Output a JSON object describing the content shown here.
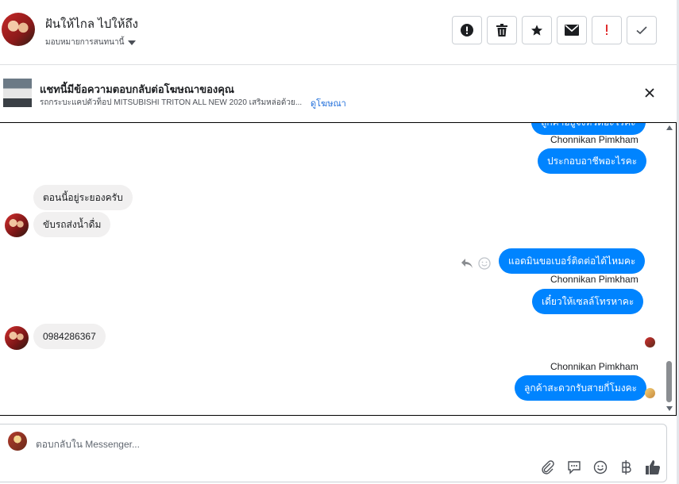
{
  "header": {
    "title": "ฝันให้ไกล ไปให้ถึง",
    "assign_label": "มอบหมายการสนทนานี้",
    "actions": [
      "exclamation-icon",
      "trash-icon",
      "star-icon",
      "envelope-icon",
      "flag-icon",
      "check-icon"
    ]
  },
  "ad_banner": {
    "title": "แชทนี้มีข้อความตอบกลับต่อโฆษณาของคุณ",
    "subtitle": "รถกระบะแคปตัวท็อป MITSUBISHI TRITON ALL NEW 2020 เสริมหล่อด้วย...",
    "link": "ดูโฆษณา"
  },
  "messages": {
    "m1_cut": "ลูกค้าอยู่จังหวัดอะไรคะ",
    "sender1": "Chonnikan Pimkham",
    "m2": "ประกอบอาชีพอะไรคะ",
    "m3": "ตอนนี้อยู่ระยองครับ",
    "m4": "ขับรถส่งน้ำดื่ม",
    "m5": "แอดมินขอเบอร์ติดต่อได้ไหมคะ",
    "sender2": "Chonnikan Pimkham",
    "m6": "เดี๋ยวให้เซลล์โทรหาคะ",
    "m7": "0984286367",
    "sender3": "Chonnikan Pimkham",
    "m8": "ลูกค้าสะดวกรับสายกี่โมงคะ"
  },
  "composer": {
    "placeholder": "ตอบกลับใน Messenger..."
  },
  "colors": {
    "accent": "#0084ff",
    "incoming": "#f1f0f0",
    "link": "#216fdb",
    "flag": "#e02e2e"
  }
}
